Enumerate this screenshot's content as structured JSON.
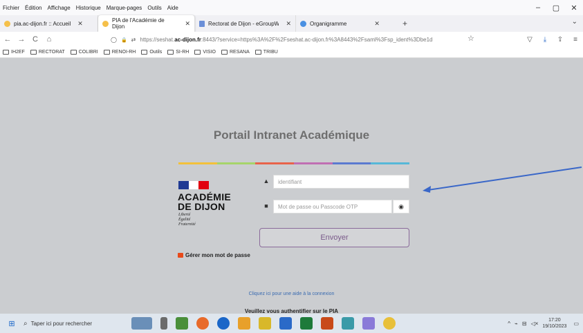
{
  "menubar": {
    "items": [
      "Fichier",
      "Édition",
      "Affichage",
      "Historique",
      "Marque-pages",
      "Outils",
      "Aide"
    ]
  },
  "window_controls": {
    "minimize": "–",
    "maximize": "▢",
    "close": "✕"
  },
  "tabs": [
    {
      "label": "pia.ac-dijon.fr :: Accueil",
      "close": "✕",
      "color": "#f5c04a"
    },
    {
      "label": "PIA de l'Académie de Dijon",
      "close": "✕",
      "color": "#f5c04a",
      "active": true
    },
    {
      "label": "Rectorat de Dijon - eGroupWare",
      "close": "✕",
      "color": "#6b8fd8"
    },
    {
      "label": "Organigramme",
      "close": "✕",
      "color": "#4a90e2"
    }
  ],
  "newtab": "+",
  "tabdown": "⌄",
  "nav": {
    "back": "←",
    "forward": "→",
    "reload": "C",
    "home": "⌂",
    "shield": "◯",
    "lock": "🔒",
    "perm": "⇄"
  },
  "url": {
    "prefix": "https://seshat.",
    "domain": "ac-dijon.fr",
    "rest": ":8443/?service=https%3A%2F%2Fseshat.ac-dijon.fr%3A8443%2Fsaml%3Fsp_ident%3Dbe1d",
    "star": "☆"
  },
  "nav_right": [
    "▽",
    "⤓",
    "⇪",
    "≡"
  ],
  "bookmarks": [
    "IH2EF",
    "RECTORAT",
    "COLIBRI",
    "RENOI-RH",
    "Outils",
    "SI-RH",
    "VISIO",
    "RESANA",
    "TRIBU"
  ],
  "portal": {
    "title": "Portail Intranet Académique",
    "stripe_colors": [
      "#f3c13a",
      "#a6d46a",
      "#e8634a",
      "#c06fb3",
      "#5b7ad0",
      "#56b8d8"
    ],
    "academy_line1": "ACADÉMIE",
    "academy_line2": "DE DIJON",
    "devise": [
      "Liberté",
      "Égalité",
      "Fraternité"
    ],
    "login_placeholder": "identifiant",
    "password_placeholder": "Mot de passe ou Passcode OTP",
    "submit": "Envoyer",
    "manage_password": "Gérer mon mot de passe",
    "help_link": "Cliquez ici pour une aide à la connexion",
    "auth_text": "Veuillez vous authentifier sur le PIA",
    "user_icon": "▲",
    "lock_icon": "■",
    "eye_icon": "◉"
  },
  "taskbar": {
    "start_icon": "⊞",
    "search_icon": "⌕",
    "search_placeholder": "Taper ici pour rechercher",
    "apps": [
      "#6a8fb8",
      "#6b6b6b",
      "#4a8f3a",
      "#e86a2a",
      "#1a66c8",
      "#e8a02a",
      "#d8b82a",
      "#2a6ac8",
      "#1d7a3a",
      "#c84a1a",
      "#3a9aa8",
      "#8a7ad8",
      "#e8c03a"
    ],
    "tray": [
      "^",
      "⌁",
      "⊟",
      "◁×"
    ],
    "time": "17:20",
    "date": "19/10/2023",
    "notif_icon": "▭"
  }
}
